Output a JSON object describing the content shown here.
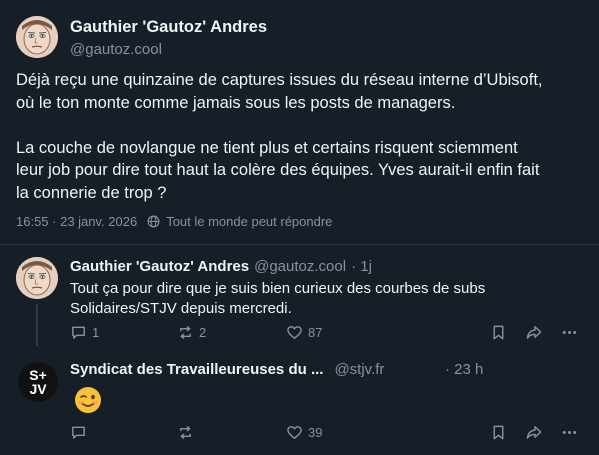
{
  "main_post": {
    "author_name": "Gauthier 'Gautoz' Andres",
    "author_handle": "@gautoz.cool",
    "paragraph1_line1": "Déjà reçu une quinzaine de captures issues du réseau interne d’Ubisoft,",
    "paragraph1_line2": "où le ton monte comme jamais sous les posts de managers.",
    "paragraph2_line1": "La couche de novlangue ne tient plus et certains risquent sciemment",
    "paragraph2_line2": "leur job pour dire tout haut la colère des équipes. Yves aurait-il enfin fait",
    "paragraph2_line3": "la connerie de trop ?",
    "timestamp": "16:55 · 23 janv. 2026",
    "audience": "Tout le monde peut répondre",
    "audience_icon": "globe-icon"
  },
  "reply1": {
    "author_name": "Gauthier 'Gautoz' Andres",
    "author_handle": "@gautoz.cool",
    "age": "· 1j",
    "text_line1": "Tout ça pour dire que je suis bien curieux des courbes de subs",
    "text_line2": "Solidaires/STJV depuis mercredi.",
    "reply_count": "1",
    "repost_count": "2",
    "like_count": "87"
  },
  "reply2": {
    "author_name": "Syndicat des Travailleureuses du ...",
    "author_handle": "@stjv.fr",
    "age": "· 23 h",
    "avatar_line1": "S+",
    "avatar_line2": "JV",
    "emoji": "winking-face-emoji",
    "reply_count": "",
    "repost_count": "",
    "like_count": "39"
  },
  "colors": {
    "background": "#161e27",
    "text": "#f1f3f5",
    "muted": "#8593a3",
    "divider": "#2e3a47"
  }
}
